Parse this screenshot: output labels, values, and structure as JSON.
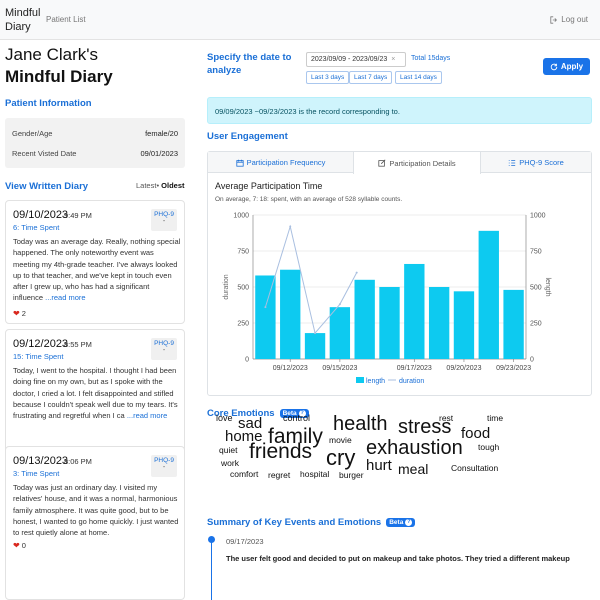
{
  "topbar": {
    "brand_line1": "Mindful",
    "brand_line2": "Diary",
    "nav_patient_list": "Patient List",
    "logout": "Log out"
  },
  "left": {
    "title_line1": "Jane Clark's",
    "title_line2": "Mindful Diary",
    "patient_info_head": "Patient Information",
    "gender_age_label": "Gender/Age",
    "gender_age_value": "female/20",
    "recent_visit_label": "Recent Visted Date",
    "recent_visit_value": "09/01/2023",
    "diary_head": "View Written Diary",
    "sort_latest": "Latest",
    "sort_sep": "•",
    "sort_oldest": "Oldest"
  },
  "diary": [
    {
      "date": "09/10/2023",
      "time": "9:49 PM",
      "spent": "6: Time Spent",
      "phq_label": "PHQ-9",
      "phq_value": "-",
      "text": "Today was an average day. Really, nothing special happened. The only noteworthy event was meeting my 4th-grade teacher. I've always looked up to that teacher, and we've kept in touch even after I grew up, who has had a significant influence",
      "more": " ...read more",
      "likes": "2"
    },
    {
      "date": "09/12/2023",
      "time": "8:55 PM",
      "spent": "15: Time Spent",
      "phq_label": "PHQ-9",
      "phq_value": "-",
      "text": "Today, I went to the hospital. I thought I had been doing fine on my own, but as I spoke with the doctor, I cried a lot. I felt disappointed and stifled because I couldn't speak well due to my tears. It's frustrating and regretful when I ca",
      "more": " ...read more",
      "likes": "4"
    },
    {
      "date": "09/13/2023",
      "time": "8:06 PM",
      "spent": "3: Time Spent",
      "phq_label": "PHQ-9",
      "phq_value": "-",
      "text": "Today was just an ordinary day. I visited my relatives' house, and it was a normal, harmonious family atmosphere. It was quite good, but to be honest, I wanted to go home quickly. I just wanted to rest quietly alone at home.",
      "more": "",
      "likes": "0"
    }
  ],
  "right": {
    "specify_line1": "Specify the date to",
    "specify_line2": "analyze",
    "date_range": "2023/09/09 - 2023/09/23",
    "date_clear": "×",
    "total": "Total 15days",
    "quick": [
      "Last 3 days",
      "Last 7 days",
      "Last 14 days"
    ],
    "apply": "Apply",
    "alert": "09/09/2023 ~09/23/2023 is the record corresponding to.",
    "engagement_head": "User Engagement",
    "tabs": [
      "Participation Frequency",
      "Participation Details",
      "PHQ-9 Score"
    ],
    "chart_title": "Average Participation Time",
    "chart_sub": "On average, 7: 18: spent, with an average of 528 syllable counts.",
    "emotions_head": "Core Emotions",
    "beta": "Beta",
    "summary_head": "Summary of Key Events and Emotions",
    "tl_date": "09/17/2023",
    "tl_text": "The user felt good and decided to put on makeup and take photos. They tried a different makeup"
  },
  "colors": {
    "accent": "#1a73e8",
    "bar": "#0dcaf0",
    "line": "#a9bfe0",
    "alert_bg": "#cff4fc"
  },
  "chart_data": {
    "type": "bar",
    "categories": [
      "09/10",
      "09/12",
      "09/13",
      "09/14",
      "09/15",
      "09/16",
      "09/17",
      "09/18",
      "09/20",
      "09/22",
      "09/23"
    ],
    "x_tick_labels": [
      "09/12/2023",
      "09/15/2023",
      "09/17/2023",
      "09/20/2023",
      "09/23/2023"
    ],
    "series": [
      {
        "name": "length",
        "values": [
          580,
          620,
          180,
          360,
          550,
          500,
          660,
          500,
          470,
          890,
          480
        ],
        "axis": "right"
      },
      {
        "name": "duration",
        "values": [
          360,
          920,
          180,
          380,
          600
        ],
        "axis": "left"
      }
    ],
    "ylabel": "duration",
    "y2label": "length",
    "ylim": [
      0,
      1000
    ],
    "yticks": [
      0,
      250,
      500,
      750,
      1000
    ],
    "y2ticks": [
      0,
      250,
      500,
      750,
      1000
    ],
    "legend": [
      "length",
      "duration"
    ],
    "legend_position": "bottom",
    "grid": true
  },
  "word_cloud": [
    {
      "text": "love"
    },
    {
      "text": "sad"
    },
    {
      "text": "control"
    },
    {
      "text": "health"
    },
    {
      "text": "stress"
    },
    {
      "text": "rest"
    },
    {
      "text": "time"
    },
    {
      "text": "home"
    },
    {
      "text": "family"
    },
    {
      "text": "food"
    },
    {
      "text": "movie"
    },
    {
      "text": "quiet"
    },
    {
      "text": "friends"
    },
    {
      "text": "cry"
    },
    {
      "text": "exhaustion"
    },
    {
      "text": "tough"
    },
    {
      "text": "work"
    },
    {
      "text": "hurt"
    },
    {
      "text": "meal"
    },
    {
      "text": "comfort"
    },
    {
      "text": "regret"
    },
    {
      "text": "hospital"
    },
    {
      "text": "burger"
    },
    {
      "text": "Consultation"
    }
  ]
}
